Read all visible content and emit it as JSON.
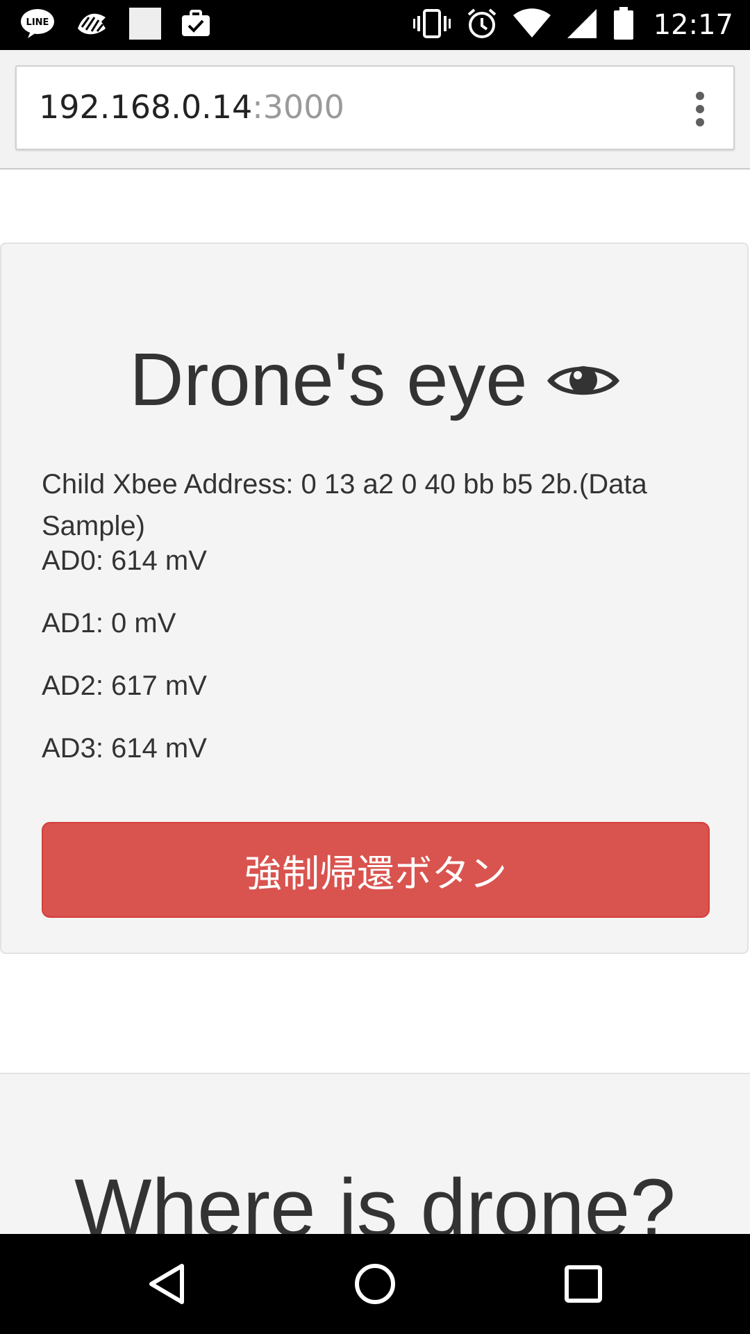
{
  "status_bar": {
    "time": "12:17",
    "left_icons": [
      "line-icon",
      "zebra-icon",
      "blank-notification-icon",
      "briefcase-check-icon"
    ],
    "right_icons": [
      "vibrate-icon",
      "alarm-icon",
      "wifi-icon",
      "cellular-icon",
      "battery-icon"
    ]
  },
  "browser": {
    "url_host": "192.168.0.14",
    "url_port": ":3000",
    "menu_icon": "overflow-menu-icon"
  },
  "card": {
    "title": "Drone's eye",
    "title_icon": "eye-icon",
    "address": "Child Xbee Address: 0 13 a2 0 40 bb b5 2b.(Data Sample)",
    "readings": [
      "AD0: 614 mV",
      "AD1: 0 mV",
      "AD2: 617 mV",
      "AD3: 614 mV"
    ],
    "return_button": "強制帰還ボタン",
    "return_button_color": "#d9534f"
  },
  "section2": {
    "title": "Where is drone?"
  },
  "nav_bar": {
    "icons": [
      "back-icon",
      "home-icon",
      "recents-icon"
    ]
  }
}
